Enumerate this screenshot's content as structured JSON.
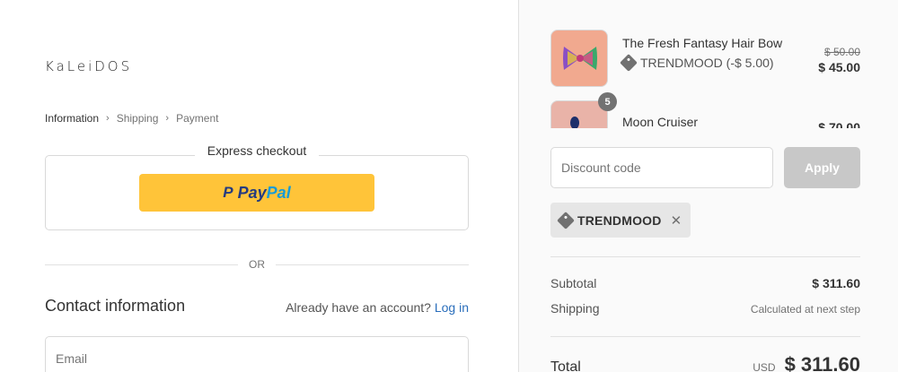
{
  "brand": {
    "logo_text": "KaLeiDOS"
  },
  "breadcrumb": [
    {
      "label": "Information"
    },
    {
      "label": "Shipping"
    },
    {
      "label": "Payment"
    }
  ],
  "express": {
    "title": "Express checkout",
    "paypal": {
      "icon": "paypal-p-icon",
      "pay": "Pay",
      "pal": "Pal"
    }
  },
  "divider_label": "OR",
  "contact": {
    "title": "Contact information",
    "account_prompt": "Already have an account?",
    "login_label": "Log in",
    "email_placeholder": "Email"
  },
  "products": [
    {
      "name": "The Fresh Fantasy Hair Bow",
      "discount": "TRENDMOOD (-$ 5.00)",
      "price_old": "$ 50.00",
      "price": "$ 45.00"
    },
    {
      "name": "Moon Cruiser",
      "quantity": "5",
      "price": "$ 70.00"
    }
  ],
  "discount": {
    "placeholder": "Discount code",
    "apply_label": "Apply",
    "applied_code": "TRENDMOOD"
  },
  "summary": {
    "subtotal_label": "Subtotal",
    "subtotal_value": "$ 311.60",
    "shipping_label": "Shipping",
    "shipping_value": "Calculated at next step",
    "total_label": "Total",
    "currency": "USD",
    "total_value": "$ 311.60"
  },
  "colors": {
    "paypal_yellow": "#ffc439",
    "paypal_dark_blue": "#253b80",
    "paypal_light_blue": "#179bd7",
    "link": "#2a6ebb",
    "apply_disabled": "#c8c8c8"
  }
}
